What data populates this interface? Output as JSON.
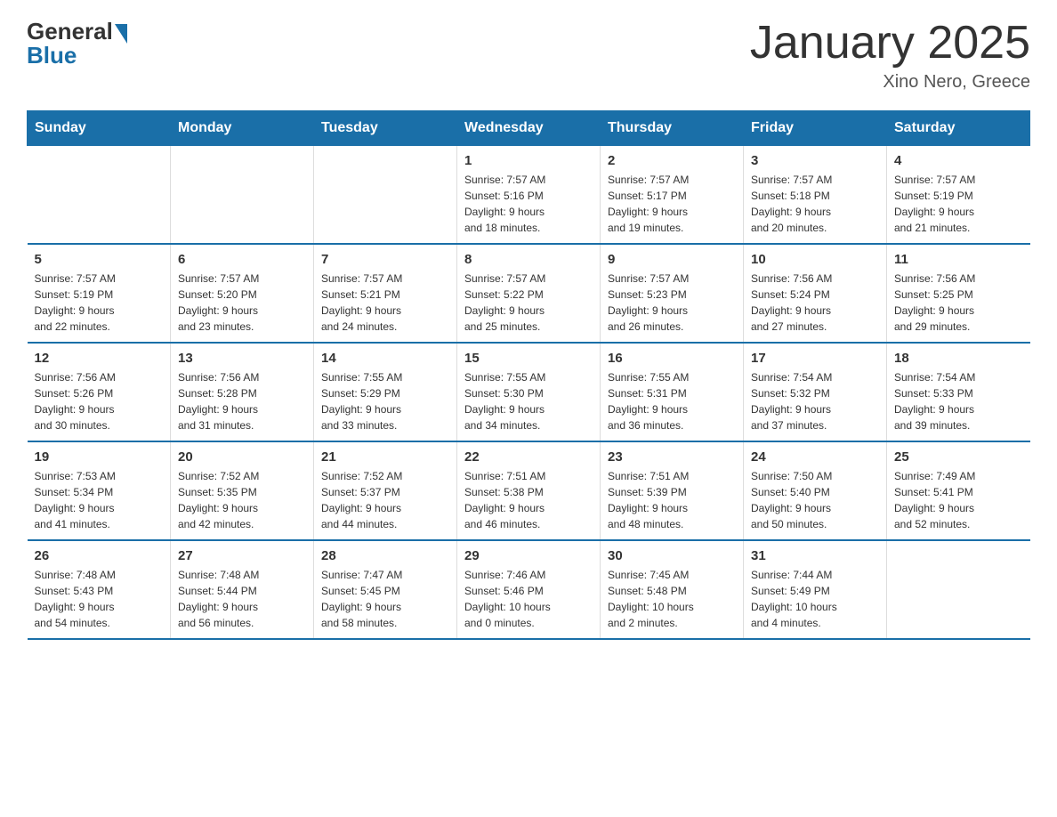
{
  "header": {
    "logo_general": "General",
    "logo_blue": "Blue",
    "month_title": "January 2025",
    "location": "Xino Nero, Greece"
  },
  "days_of_week": [
    "Sunday",
    "Monday",
    "Tuesday",
    "Wednesday",
    "Thursday",
    "Friday",
    "Saturday"
  ],
  "weeks": [
    [
      {
        "day": "",
        "info": ""
      },
      {
        "day": "",
        "info": ""
      },
      {
        "day": "",
        "info": ""
      },
      {
        "day": "1",
        "info": "Sunrise: 7:57 AM\nSunset: 5:16 PM\nDaylight: 9 hours\nand 18 minutes."
      },
      {
        "day": "2",
        "info": "Sunrise: 7:57 AM\nSunset: 5:17 PM\nDaylight: 9 hours\nand 19 minutes."
      },
      {
        "day": "3",
        "info": "Sunrise: 7:57 AM\nSunset: 5:18 PM\nDaylight: 9 hours\nand 20 minutes."
      },
      {
        "day": "4",
        "info": "Sunrise: 7:57 AM\nSunset: 5:19 PM\nDaylight: 9 hours\nand 21 minutes."
      }
    ],
    [
      {
        "day": "5",
        "info": "Sunrise: 7:57 AM\nSunset: 5:19 PM\nDaylight: 9 hours\nand 22 minutes."
      },
      {
        "day": "6",
        "info": "Sunrise: 7:57 AM\nSunset: 5:20 PM\nDaylight: 9 hours\nand 23 minutes."
      },
      {
        "day": "7",
        "info": "Sunrise: 7:57 AM\nSunset: 5:21 PM\nDaylight: 9 hours\nand 24 minutes."
      },
      {
        "day": "8",
        "info": "Sunrise: 7:57 AM\nSunset: 5:22 PM\nDaylight: 9 hours\nand 25 minutes."
      },
      {
        "day": "9",
        "info": "Sunrise: 7:57 AM\nSunset: 5:23 PM\nDaylight: 9 hours\nand 26 minutes."
      },
      {
        "day": "10",
        "info": "Sunrise: 7:56 AM\nSunset: 5:24 PM\nDaylight: 9 hours\nand 27 minutes."
      },
      {
        "day": "11",
        "info": "Sunrise: 7:56 AM\nSunset: 5:25 PM\nDaylight: 9 hours\nand 29 minutes."
      }
    ],
    [
      {
        "day": "12",
        "info": "Sunrise: 7:56 AM\nSunset: 5:26 PM\nDaylight: 9 hours\nand 30 minutes."
      },
      {
        "day": "13",
        "info": "Sunrise: 7:56 AM\nSunset: 5:28 PM\nDaylight: 9 hours\nand 31 minutes."
      },
      {
        "day": "14",
        "info": "Sunrise: 7:55 AM\nSunset: 5:29 PM\nDaylight: 9 hours\nand 33 minutes."
      },
      {
        "day": "15",
        "info": "Sunrise: 7:55 AM\nSunset: 5:30 PM\nDaylight: 9 hours\nand 34 minutes."
      },
      {
        "day": "16",
        "info": "Sunrise: 7:55 AM\nSunset: 5:31 PM\nDaylight: 9 hours\nand 36 minutes."
      },
      {
        "day": "17",
        "info": "Sunrise: 7:54 AM\nSunset: 5:32 PM\nDaylight: 9 hours\nand 37 minutes."
      },
      {
        "day": "18",
        "info": "Sunrise: 7:54 AM\nSunset: 5:33 PM\nDaylight: 9 hours\nand 39 minutes."
      }
    ],
    [
      {
        "day": "19",
        "info": "Sunrise: 7:53 AM\nSunset: 5:34 PM\nDaylight: 9 hours\nand 41 minutes."
      },
      {
        "day": "20",
        "info": "Sunrise: 7:52 AM\nSunset: 5:35 PM\nDaylight: 9 hours\nand 42 minutes."
      },
      {
        "day": "21",
        "info": "Sunrise: 7:52 AM\nSunset: 5:37 PM\nDaylight: 9 hours\nand 44 minutes."
      },
      {
        "day": "22",
        "info": "Sunrise: 7:51 AM\nSunset: 5:38 PM\nDaylight: 9 hours\nand 46 minutes."
      },
      {
        "day": "23",
        "info": "Sunrise: 7:51 AM\nSunset: 5:39 PM\nDaylight: 9 hours\nand 48 minutes."
      },
      {
        "day": "24",
        "info": "Sunrise: 7:50 AM\nSunset: 5:40 PM\nDaylight: 9 hours\nand 50 minutes."
      },
      {
        "day": "25",
        "info": "Sunrise: 7:49 AM\nSunset: 5:41 PM\nDaylight: 9 hours\nand 52 minutes."
      }
    ],
    [
      {
        "day": "26",
        "info": "Sunrise: 7:48 AM\nSunset: 5:43 PM\nDaylight: 9 hours\nand 54 minutes."
      },
      {
        "day": "27",
        "info": "Sunrise: 7:48 AM\nSunset: 5:44 PM\nDaylight: 9 hours\nand 56 minutes."
      },
      {
        "day": "28",
        "info": "Sunrise: 7:47 AM\nSunset: 5:45 PM\nDaylight: 9 hours\nand 58 minutes."
      },
      {
        "day": "29",
        "info": "Sunrise: 7:46 AM\nSunset: 5:46 PM\nDaylight: 10 hours\nand 0 minutes."
      },
      {
        "day": "30",
        "info": "Sunrise: 7:45 AM\nSunset: 5:48 PM\nDaylight: 10 hours\nand 2 minutes."
      },
      {
        "day": "31",
        "info": "Sunrise: 7:44 AM\nSunset: 5:49 PM\nDaylight: 10 hours\nand 4 minutes."
      },
      {
        "day": "",
        "info": ""
      }
    ]
  ]
}
